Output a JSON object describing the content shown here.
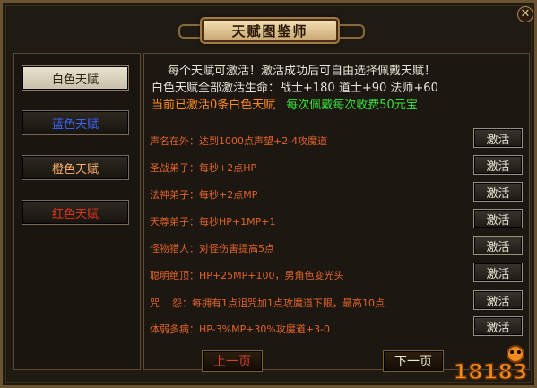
{
  "window": {
    "title": "天赋图鉴师",
    "close_label": "✕"
  },
  "sidebar": {
    "tabs": [
      {
        "label": "白色天赋",
        "color": "#2b1e0e",
        "active": true
      },
      {
        "label": "蓝色天赋",
        "color": "#3a66ff",
        "active": false
      },
      {
        "label": "橙色天赋",
        "color": "#ffb06a",
        "active": false
      },
      {
        "label": "红色天赋",
        "color": "#e8321c",
        "active": false
      }
    ]
  },
  "info": {
    "line1": "每个天赋可激活！激活成功后可自由选择佩戴天赋！",
    "line2": "白色天赋全部激活生命：战士+180 道士+90 法师+60",
    "line3_prefix": "当前已激活0条白色天赋",
    "line3_fee": "每次佩戴每次收费50元宝"
  },
  "talents": [
    {
      "name": "声名在外：",
      "desc": "达到1000点声望+2-4攻魔道",
      "button": "激活"
    },
    {
      "name": "圣战弟子：",
      "desc": "每秒+2点HP",
      "button": "激活"
    },
    {
      "name": "法神弟子：",
      "desc": "每秒+2点MP",
      "button": "激活"
    },
    {
      "name": "天尊弟子：",
      "desc": "每秒HP+1MP+1",
      "button": "激活"
    },
    {
      "name": "怪物猎人：",
      "desc": "对怪伤害提高5点",
      "button": "激活"
    },
    {
      "name": "聪明绝顶：",
      "desc": "HP+25MP+100，男角色变光头",
      "button": "激活"
    },
    {
      "name": "咒    怨：",
      "desc": "每拥有1点诅咒加1点攻魔道下限，最高10点",
      "button": "激活"
    },
    {
      "name": "体弱多病：",
      "desc": "HP-3%MP+30%攻魔道+3-0",
      "button": "激活"
    }
  ],
  "pager": {
    "prev_label": "上一页",
    "next_label": "下一页"
  },
  "watermark": {
    "text": "18183"
  },
  "colors": {
    "accent_orange": "#ff8a1e",
    "fee_green": "#39e03a",
    "row_text": "#e2622a"
  }
}
